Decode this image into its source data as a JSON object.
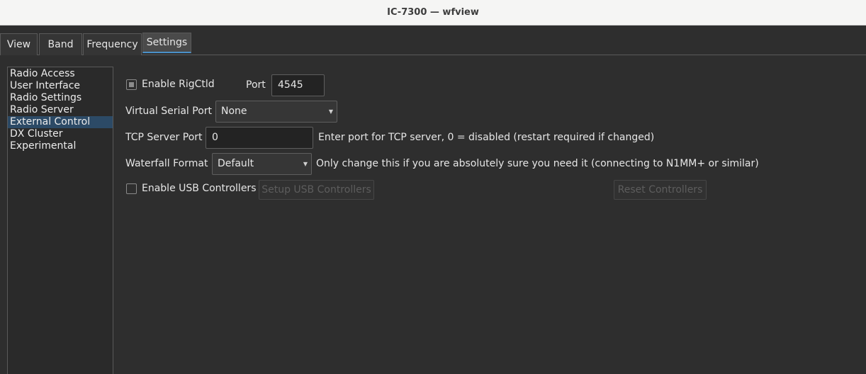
{
  "window": {
    "title": "IC-7300 — wfview"
  },
  "tabs": [
    {
      "label": "View"
    },
    {
      "label": "Band"
    },
    {
      "label": "Frequency"
    },
    {
      "label": "Settings",
      "active": true
    }
  ],
  "sidebar": {
    "items": [
      {
        "label": "Radio Access"
      },
      {
        "label": "User Interface"
      },
      {
        "label": "Radio Settings"
      },
      {
        "label": "Radio Server"
      },
      {
        "label": "External Control",
        "selected": true
      },
      {
        "label": "DX Cluster"
      },
      {
        "label": "Experimental"
      }
    ]
  },
  "settings": {
    "rigctld": {
      "label": "Enable RigCtld",
      "checked": "partial"
    },
    "port": {
      "label": "Port",
      "value": "4545"
    },
    "virtual_serial": {
      "label": "Virtual Serial Port",
      "value": "None"
    },
    "tcp_server": {
      "label": "TCP Server Port",
      "value": "0",
      "hint": "Enter port for TCP server, 0 = disabled (restart required if changed)"
    },
    "waterfall": {
      "label": "Waterfall Format",
      "value": "Default",
      "hint": "Only change this if you are absolutely sure you need it (connecting to N1MM+ or similar)"
    },
    "usb": {
      "label": "Enable USB Controllers",
      "checked": false,
      "setup_button": "Setup USB Controllers",
      "reset_button": "Reset Controllers"
    }
  },
  "colors": {
    "background": "#2e2e2e",
    "selection": "#2c4a66",
    "active_tab_accent": "#4a90c8"
  }
}
